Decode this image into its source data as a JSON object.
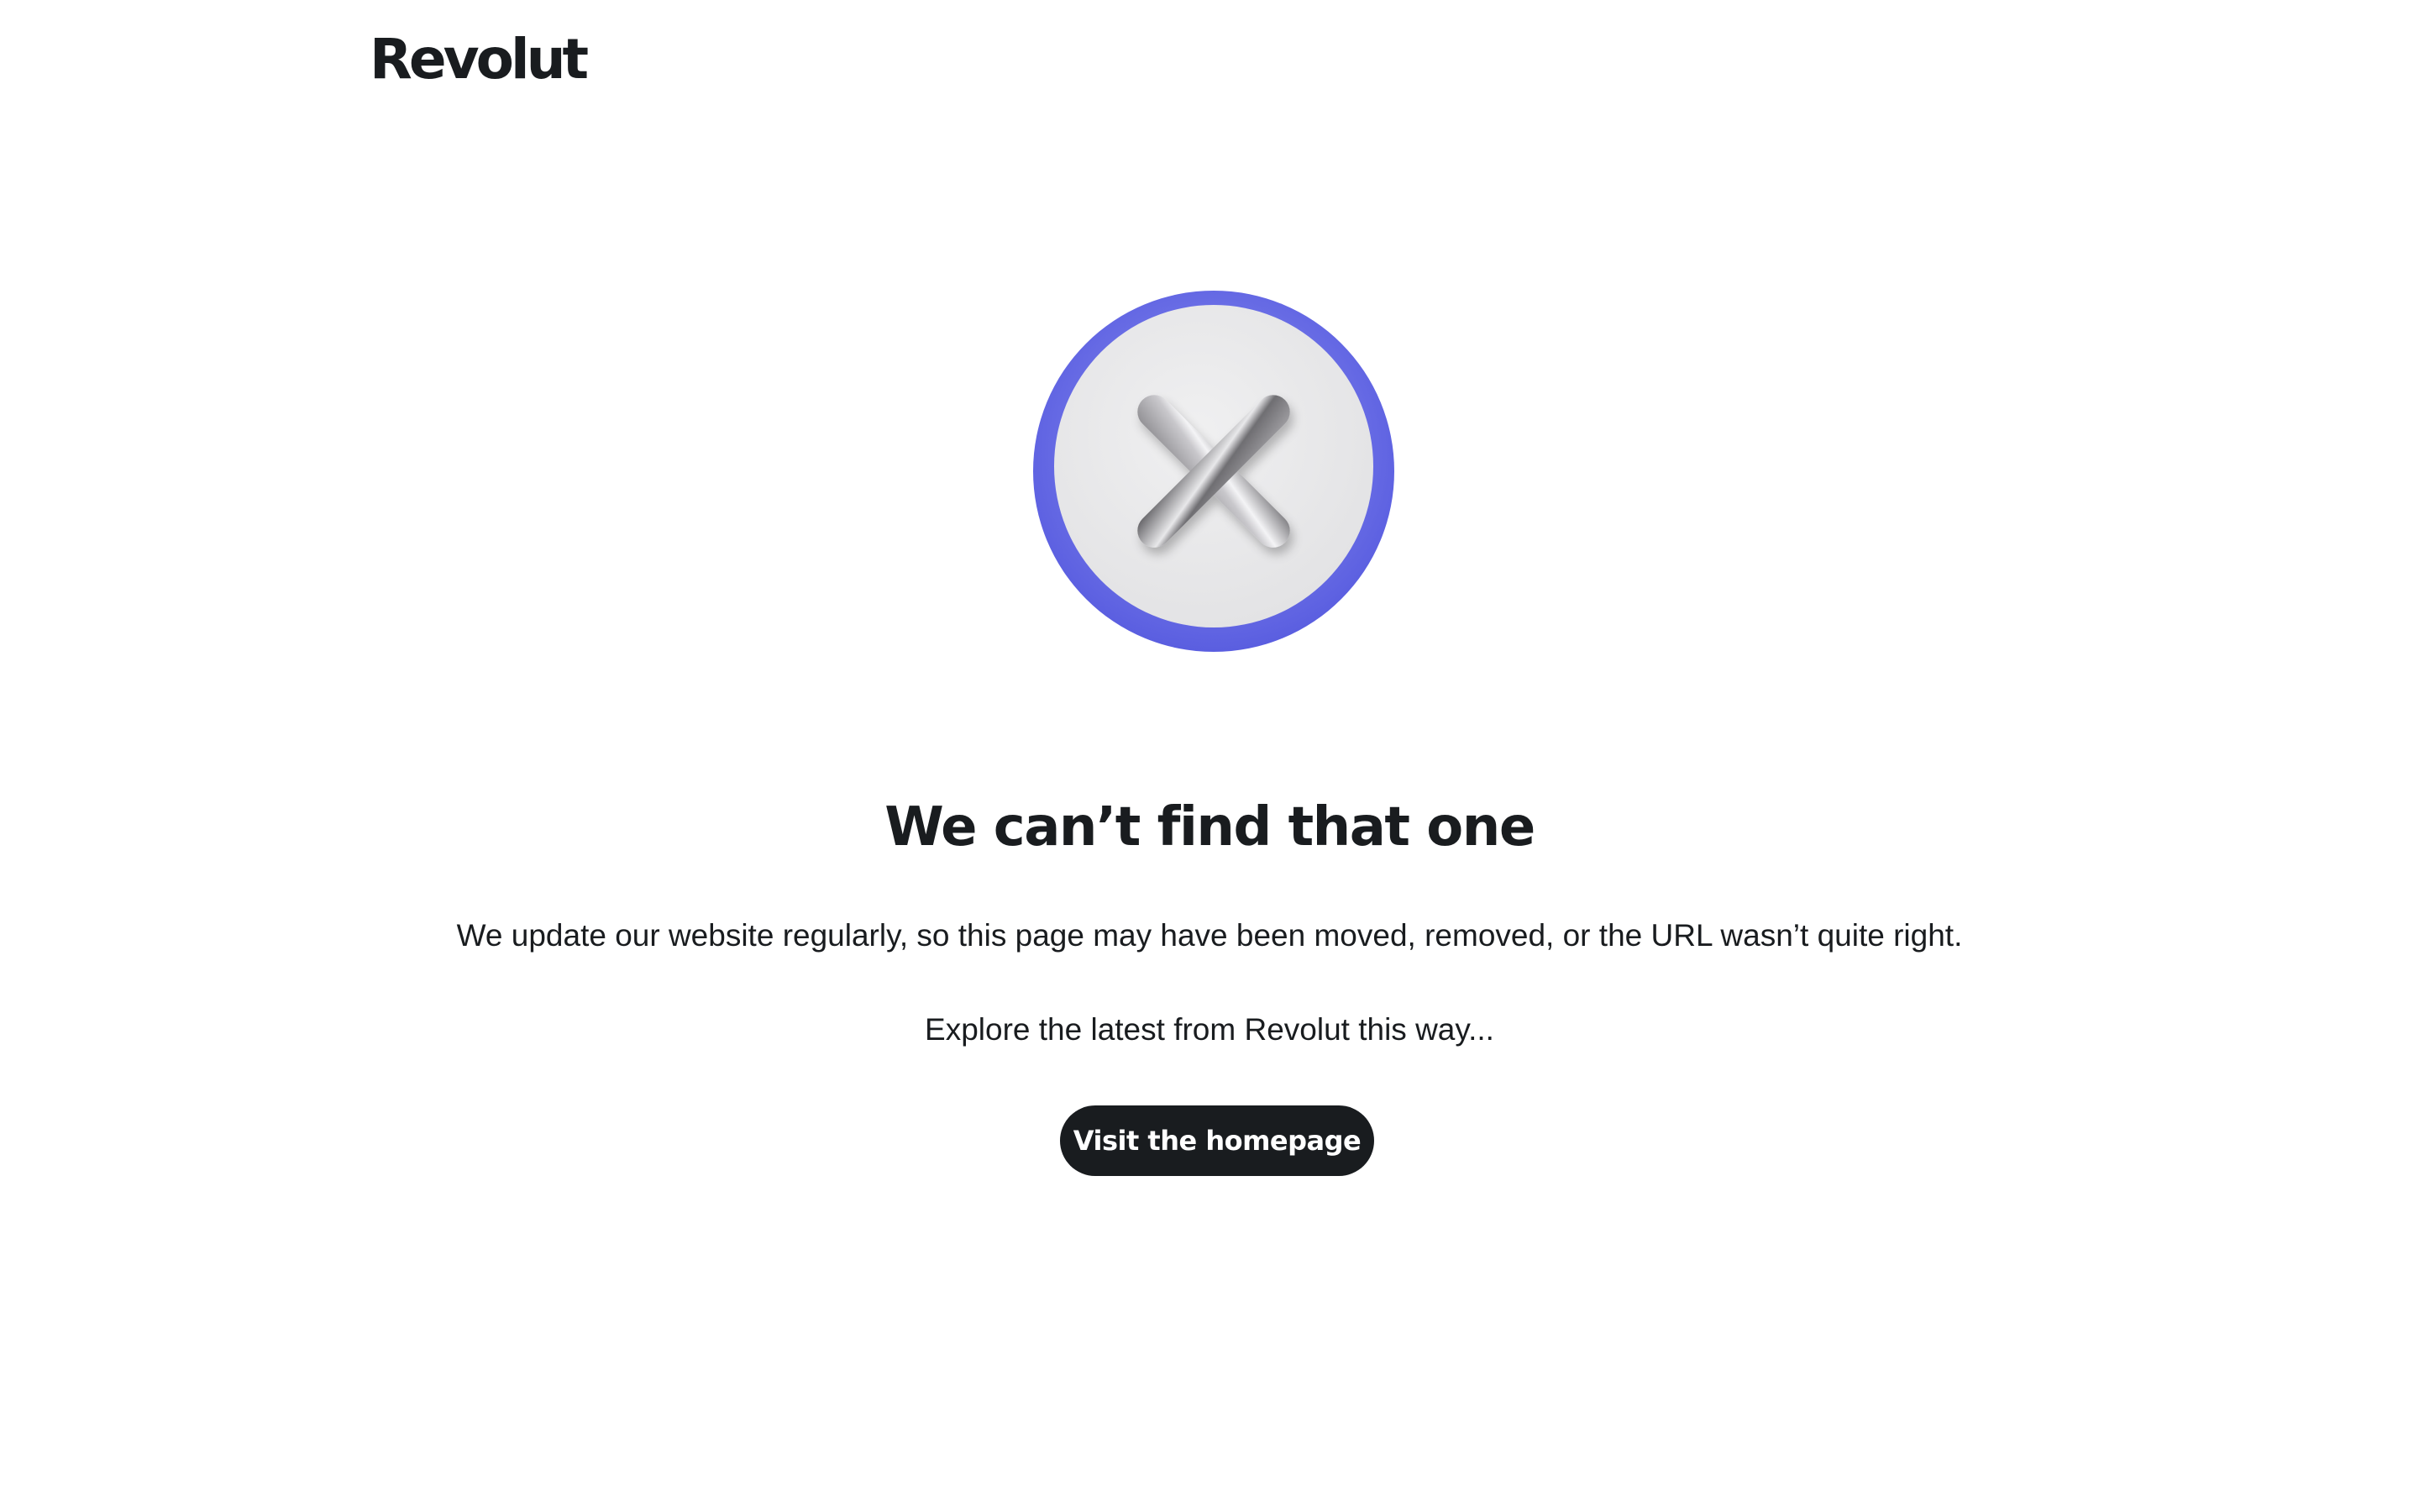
{
  "header": {
    "logo_text": "Revolut"
  },
  "hero": {
    "icon": "close-x-icon",
    "ring_color": "#6b6fe6",
    "disc_color": "#ebebec"
  },
  "main": {
    "title": "We can’t find that one",
    "description": "We update our website regularly, so this page may have been moved, removed, or the URL wasn’t quite right.",
    "explore_text": "Explore the latest from Revolut this way...",
    "cta_label": "Visit the homepage"
  },
  "colors": {
    "text": "#191c1f",
    "button_bg": "#191c1f",
    "button_text": "#ffffff",
    "background": "#ffffff"
  }
}
